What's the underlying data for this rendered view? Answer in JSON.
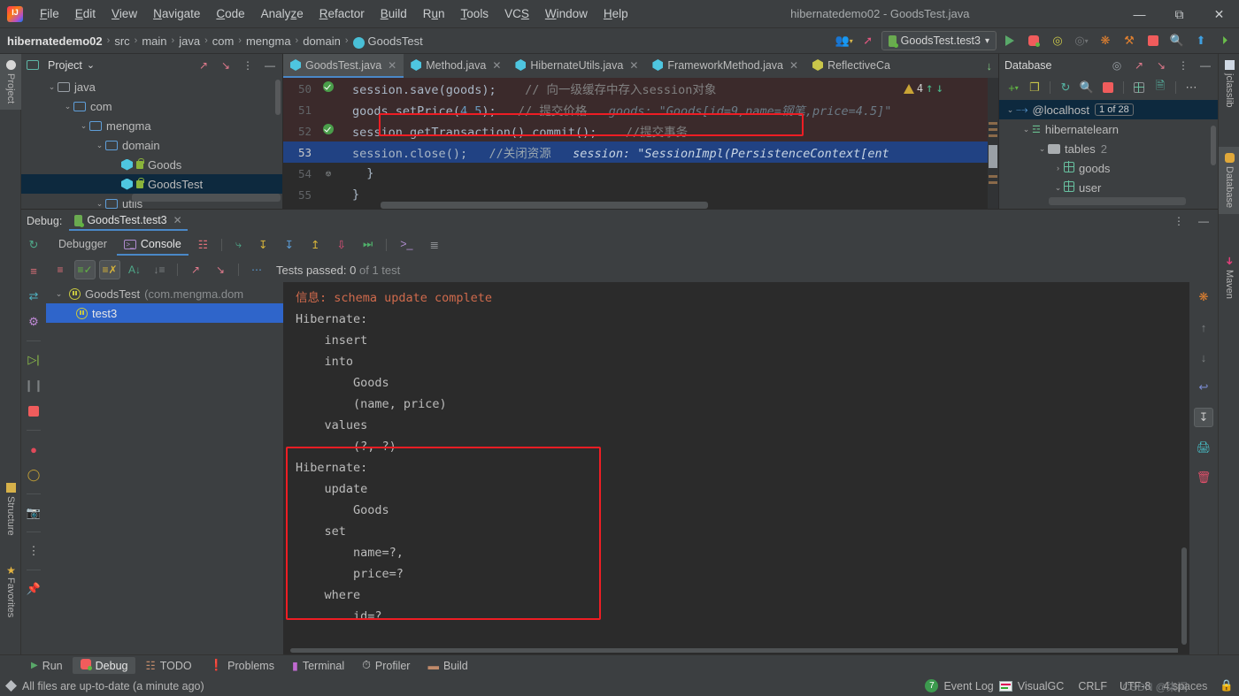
{
  "window": {
    "title": "hibernatedemo02 - GoodsTest.java",
    "controls": {
      "minimize": "—",
      "maximize": "❐",
      "close": "✕"
    }
  },
  "menubar": [
    {
      "label": "File"
    },
    {
      "label": "Edit"
    },
    {
      "label": "View"
    },
    {
      "label": "Navigate"
    },
    {
      "label": "Code"
    },
    {
      "label": "Analyze"
    },
    {
      "label": "Refactor"
    },
    {
      "label": "Build"
    },
    {
      "label": "Run"
    },
    {
      "label": "Tools"
    },
    {
      "label": "VCS"
    },
    {
      "label": "Window"
    },
    {
      "label": "Help"
    }
  ],
  "breadcrumb": {
    "project": "hibernatedemo02",
    "items": [
      "src",
      "main",
      "java",
      "com",
      "mengma",
      "domain"
    ],
    "file": "GoodsTest",
    "separator": "›"
  },
  "toolbar": {
    "run_config": "GoodsTest.test3",
    "run_config_caret": "▾",
    "icons": [
      "users-icon",
      "hammer-icon",
      "run-icon",
      "debug-icon",
      "run-coverage-icon",
      "profile-icon",
      "attach-icon",
      "build-icon",
      "stop-icon",
      "search-icon",
      "update-icon",
      "idea-icon"
    ]
  },
  "left_rail": [
    {
      "label": "Project",
      "active": true
    },
    {
      "label": "Structure",
      "active": false
    },
    {
      "label": "Favorites",
      "active": false
    }
  ],
  "right_rail": [
    {
      "label": "jclasslib",
      "active": false
    },
    {
      "label": "Database",
      "active": true
    },
    {
      "label": "Maven",
      "active": false
    }
  ],
  "project_panel": {
    "title": "Project",
    "title_caret": "⌄",
    "tools": [
      "expand-icon",
      "collapse-icon",
      "more-icon",
      "hide-icon"
    ],
    "tree": [
      {
        "indent": 1,
        "chevron": "⌄",
        "icon": "folder-plain",
        "label": "java",
        "selected": false
      },
      {
        "indent": 2,
        "chevron": "⌄",
        "icon": "folder-blue",
        "label": "com",
        "selected": false
      },
      {
        "indent": 3,
        "chevron": "⌄",
        "icon": "folder-blue",
        "label": "mengma",
        "selected": false
      },
      {
        "indent": 4,
        "chevron": "⌄",
        "icon": "folder-blue",
        "label": "domain",
        "selected": false
      },
      {
        "indent": 5,
        "chevron": "",
        "icon": "java-class",
        "label": "Goods",
        "selected": false,
        "lock": true
      },
      {
        "indent": 5,
        "chevron": "",
        "icon": "java-class",
        "label": "GoodsTest",
        "selected": true,
        "lock": true
      },
      {
        "indent": 4,
        "chevron": "⌄",
        "icon": "folder-blue",
        "label": "utils",
        "selected": false
      }
    ]
  },
  "editor": {
    "tabs": [
      {
        "label": "GoodsTest.java",
        "icon": "java-class-icon",
        "active": true,
        "close": "✕"
      },
      {
        "label": "Method.java",
        "icon": "java-class-icon",
        "active": false,
        "close": "✕"
      },
      {
        "label": "HibernateUtils.java",
        "icon": "java-class-icon",
        "active": false,
        "close": "✕"
      },
      {
        "label": "FrameworkMethod.java",
        "icon": "java-class-icon",
        "active": false,
        "close": "✕"
      },
      {
        "label": "ReflectiveCa",
        "icon": "java-class-yellow-icon",
        "active": false,
        "close": ""
      }
    ],
    "tabs_overflow": "↓",
    "warnings_count": "4",
    "warn_up": "↑",
    "warn_down": "↓",
    "lines": [
      {
        "number": "50",
        "marker": "breakpoint-verified",
        "bg": "red",
        "segments": [
          {
            "t": "session",
            "c": "id"
          },
          {
            "t": ".",
            "c": "p"
          },
          {
            "t": "save",
            "c": "fn"
          },
          {
            "t": "(",
            "c": "p"
          },
          {
            "t": "goods",
            "c": "id"
          },
          {
            "t": ");",
            "c": "p"
          },
          {
            "t": "    // 向一级缓存中存入session对象",
            "c": "cm"
          }
        ]
      },
      {
        "number": "51",
        "marker": "",
        "bg": "red",
        "segments": [
          {
            "t": "goods",
            "c": "id"
          },
          {
            "t": ".",
            "c": "p"
          },
          {
            "t": "setPrice",
            "c": "fn"
          },
          {
            "t": "(",
            "c": "p"
          },
          {
            "t": "4.5",
            "c": "num"
          },
          {
            "t": ");",
            "c": "p"
          },
          {
            "t": "   // 提交价格",
            "c": "cm"
          },
          {
            "t": "   goods: \"Goods[id=9,name=钢笔,price=4.5]\"",
            "c": "hint"
          }
        ]
      },
      {
        "number": "52",
        "marker": "breakpoint-verified",
        "bg": "red",
        "boxed": true,
        "segments": [
          {
            "t": "session",
            "c": "id"
          },
          {
            "t": ".",
            "c": "p"
          },
          {
            "t": "getTransaction",
            "c": "fn"
          },
          {
            "t": "()",
            "c": "p"
          },
          {
            "t": ".",
            "c": "p"
          },
          {
            "t": "commit",
            "c": "fn"
          },
          {
            "t": "();",
            "c": "p"
          },
          {
            "t": "    //提交事务",
            "c": "cm"
          }
        ]
      },
      {
        "number": "53",
        "marker": "",
        "bg": "blue",
        "current": true,
        "segments": [
          {
            "t": "session",
            "c": "id"
          },
          {
            "t": ".",
            "c": "p"
          },
          {
            "t": "close",
            "c": "fn"
          },
          {
            "t": "();",
            "c": "p"
          },
          {
            "t": "   //关闭资源",
            "c": "cm"
          },
          {
            "t": "   session: \"SessionImpl(PersistenceContext[ent",
            "c": "hint"
          }
        ]
      },
      {
        "number": "54",
        "marker": "fold",
        "bg": "",
        "segments": [
          {
            "t": "}",
            "c": "p"
          }
        ]
      },
      {
        "number": "55",
        "marker": "",
        "bg": "",
        "segments": [
          {
            "t": "}",
            "c": "p"
          }
        ]
      }
    ]
  },
  "database_panel": {
    "title": "Database",
    "tools": [
      "target-icon",
      "expand-icon",
      "collapse-icon",
      "more-icon",
      "hide-icon"
    ],
    "toolbar_icons": [
      "add-icon",
      "copy-icon",
      "refresh-icon",
      "query-console-icon",
      "stop-icon",
      "table-icon",
      "script-icon",
      "more-icon"
    ],
    "tree": [
      {
        "indent": 0,
        "chevron": "⌄",
        "icon": "datasource-icon",
        "label": "@localhost",
        "badge": "1 of 28",
        "selected": true
      },
      {
        "indent": 1,
        "chevron": "⌄",
        "icon": "schema-icon",
        "label": "hibernatelearn",
        "selected": false
      },
      {
        "indent": 2,
        "chevron": "⌄",
        "icon": "folder-solid",
        "label": "tables",
        "count": "2",
        "selected": false
      },
      {
        "indent": 3,
        "chevron": "›",
        "icon": "table-icon",
        "label": "goods",
        "selected": false
      },
      {
        "indent": 3,
        "chevron": "⌄",
        "icon": "table-icon",
        "label": "user",
        "selected": false
      }
    ]
  },
  "debug_panel": {
    "label": "Debug:",
    "tab": "GoodsTest.test3",
    "tab_close": "✕",
    "more": "⋮",
    "hide": "—",
    "tabs": [
      {
        "label": "Debugger",
        "active": false
      },
      {
        "label": "Console",
        "active": true,
        "icon": "console-icon"
      }
    ],
    "stepper_icons": [
      "show-execution-point-icon",
      "step-over-icon",
      "step-into-icon",
      "step-out-icon",
      "run-to-cursor-icon",
      "force-step-icon",
      "evaluate-icon",
      "layout-icon"
    ],
    "side_icons": [
      "rerun-icon",
      "rerun-failed-icon",
      "toggle-icon",
      "settings-icon",
      "resume-icon",
      "pause-icon",
      "stop-icon",
      "breakpoints-icon",
      "mute-breakpoints-icon",
      "screenshot-icon",
      "more-icon",
      "pin-icon"
    ],
    "filter_icons": [
      "hide-passed-icon",
      "show-ignored-icon",
      "sort-alpha-icon",
      "sort-duration-icon",
      "expand-all-icon",
      "collapse-all-icon",
      "more-icon"
    ],
    "tests_status_label": "Tests passed:",
    "tests_passed": "0",
    "tests_total": "of 1 test",
    "test_tree": [
      {
        "indent": 0,
        "chevron": "⌄",
        "label": "GoodsTest",
        "sub": "(com.mengma.dom",
        "selected": false
      },
      {
        "indent": 1,
        "chevron": "",
        "label": "test3",
        "sub": "",
        "selected": true
      }
    ],
    "console_lines": [
      {
        "text": "信息: schema update complete",
        "color": "red"
      },
      {
        "text": "Hibernate: ",
        "color": ""
      },
      {
        "text": "    insert ",
        "color": ""
      },
      {
        "text": "    into",
        "color": ""
      },
      {
        "text": "        Goods",
        "color": ""
      },
      {
        "text": "        (name, price) ",
        "color": ""
      },
      {
        "text": "    values",
        "color": ""
      },
      {
        "text": "        (?, ?)",
        "color": ""
      },
      {
        "text": "Hibernate: ",
        "color": "",
        "boxed_start": true
      },
      {
        "text": "    update",
        "color": ""
      },
      {
        "text": "        Goods ",
        "color": ""
      },
      {
        "text": "    set",
        "color": ""
      },
      {
        "text": "        name=?,",
        "color": ""
      },
      {
        "text": "        price=?",
        "color": ""
      },
      {
        "text": "    where",
        "color": ""
      },
      {
        "text": "        id=?",
        "color": "",
        "boxed_end": true
      }
    ],
    "console_rail_icons": [
      "attach-profiler-icon",
      "scroll-up-icon",
      "scroll-down-icon",
      "soft-wrap-icon",
      "scroll-to-end-icon",
      "print-icon",
      "clear-all-icon"
    ]
  },
  "status": {
    "tool_buttons": [
      {
        "label": "Run",
        "icon": "run-icon",
        "active": false
      },
      {
        "label": "Debug",
        "icon": "debug-icon",
        "active": true
      },
      {
        "label": "TODO",
        "icon": "todo-icon",
        "active": false
      },
      {
        "label": "Problems",
        "icon": "problems-icon",
        "active": false
      },
      {
        "label": "Terminal",
        "icon": "terminal-icon",
        "active": false
      },
      {
        "label": "Profiler",
        "icon": "profiler-icon",
        "active": false
      },
      {
        "label": "Build",
        "icon": "build-icon",
        "active": false
      }
    ],
    "message": "All files are up-to-date (a minute ago)",
    "event_log_count": "7",
    "event_log": "Event Log",
    "visual_gc": "VisualGC",
    "line_ending": "CRLF",
    "encoding": "UTF-8",
    "indent": "4 spaces",
    "watermark": "CSDN @柒间"
  },
  "colors": {
    "accent_blue": "#4a88c7",
    "highlight_red": "#ee1d24",
    "selection_blue": "#214283",
    "editor_bg": "#2b2b2b",
    "panel_bg": "#3c3f41",
    "error_red": "#cf6a4c",
    "green": "#59a869"
  }
}
